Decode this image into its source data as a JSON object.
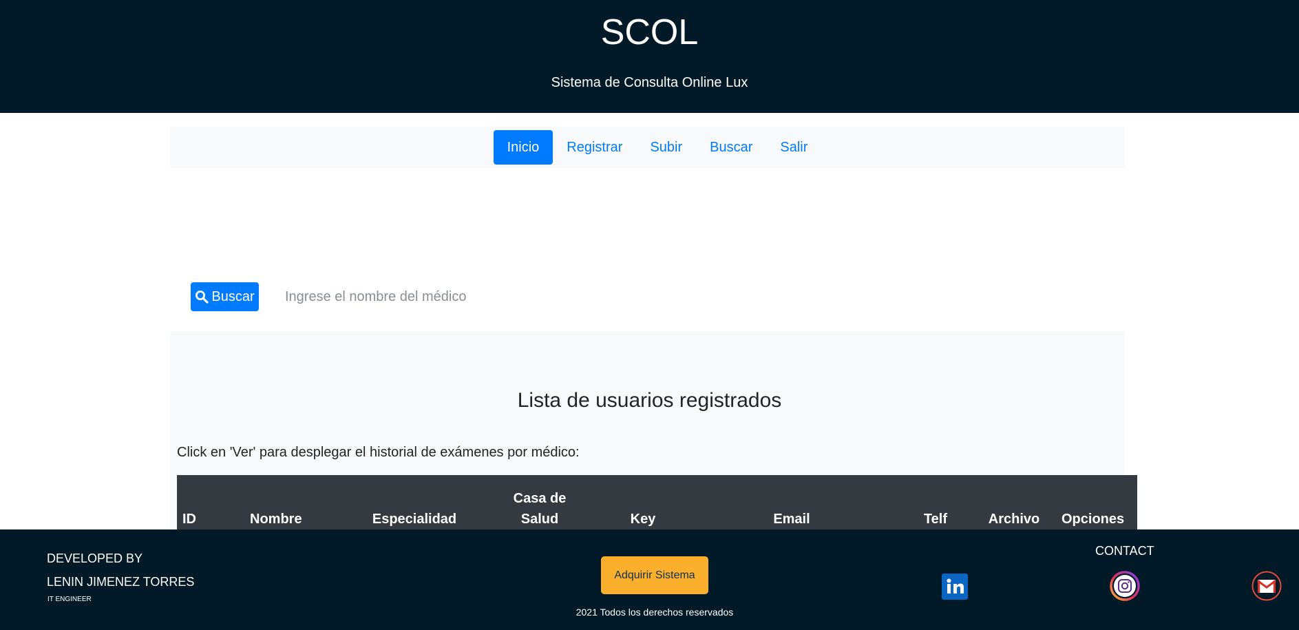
{
  "header": {
    "title": "SCOL",
    "subtitle": "Sistema de Consulta Online Lux"
  },
  "nav": {
    "items": [
      {
        "label": "Inicio",
        "active": true
      },
      {
        "label": "Registrar"
      },
      {
        "label": "Subir"
      },
      {
        "label": "Buscar"
      },
      {
        "label": "Salir"
      }
    ]
  },
  "search": {
    "button_label": "Buscar",
    "placeholder": "Ingrese el nombre del médico",
    "value": ""
  },
  "panel": {
    "title": "Lista de usuarios registrados",
    "instructions": "Click en 'Ver' para desplegar el historial de exámenes por médico:"
  },
  "table": {
    "columns": [
      {
        "line1": "",
        "line2": "ID"
      },
      {
        "line1": "",
        "line2": "Nombre"
      },
      {
        "line1": "",
        "line2": "Especialidad"
      },
      {
        "line1": "Casa de",
        "line2": "Salud"
      },
      {
        "line1": "",
        "line2": "Key"
      },
      {
        "line1": "",
        "line2": "Email"
      },
      {
        "line1": "",
        "line2": "Telf"
      },
      {
        "line1": "",
        "line2": "Archivo"
      },
      {
        "line1": "",
        "line2": "Opciones"
      }
    ]
  },
  "footer": {
    "developed_by": "DEVELOPED BY",
    "developer_name": "LENIN JIMENEZ TORRES",
    "developer_role": "IT ENGINEER",
    "acquire_label": "Adquirir Sistema",
    "copyright": "2021 Todos los derechos reservados",
    "contact_label": "CONTACT",
    "social": [
      {
        "icon": "linkedin-icon"
      },
      {
        "icon": "instagram-icon"
      },
      {
        "icon": "gmail-icon"
      }
    ]
  },
  "colors": {
    "header_bg": "#021a27",
    "primary": "#007bff",
    "panel_bg": "#f8f9fa",
    "table_head_bg": "#343a40",
    "acquire_bg": "#fbb02d"
  }
}
